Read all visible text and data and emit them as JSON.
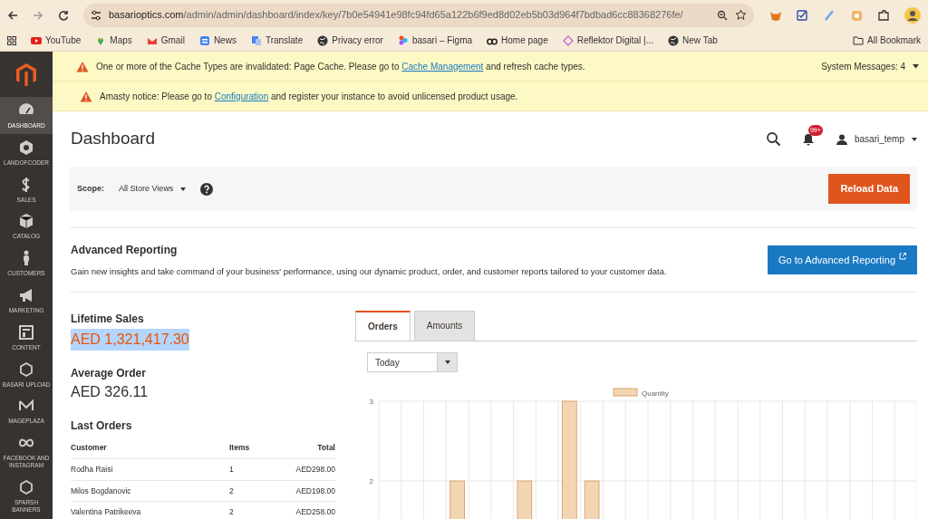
{
  "browser": {
    "url_host": "basarioptics.com",
    "url_path": "/admin/admin/dashboard/index/key/7b0e54941e98fc94fd65a122b6f9ed8d02eb5b03d964f7bdbad6cc88368276fe/",
    "bookmarks": [
      {
        "label": "YouTube"
      },
      {
        "label": "Maps"
      },
      {
        "label": "Gmail"
      },
      {
        "label": "News"
      },
      {
        "label": "Translate"
      },
      {
        "label": "Privacy error"
      },
      {
        "label": "basari – Figma"
      },
      {
        "label": "Home page"
      },
      {
        "label": "Reflektor Digital |..."
      },
      {
        "label": "New Tab"
      }
    ],
    "all_bookmarks": "All Bookmark"
  },
  "sidebar": {
    "items": [
      {
        "label": "DASHBOARD",
        "selected": true
      },
      {
        "label": "LANDOFCODER",
        "selected": false
      },
      {
        "label": "SALES",
        "selected": false
      },
      {
        "label": "CATALOG",
        "selected": false
      },
      {
        "label": "CUSTOMERS",
        "selected": false
      },
      {
        "label": "MARKETING",
        "selected": false
      },
      {
        "label": "CONTENT",
        "selected": false
      },
      {
        "label": "BASARI UPLOAD",
        "selected": false
      },
      {
        "label": "MAGEPLAZA",
        "selected": false
      },
      {
        "label": "FACEBOOK AND INSTAGRAM",
        "selected": false
      },
      {
        "label": "SPARSH BANNERS",
        "selected": false
      }
    ]
  },
  "messages": [
    {
      "before": "One or more of the Cache Types are invalidated: Page Cache. Please go to ",
      "link": "Cache Management",
      "after": " and refresh cache types."
    },
    {
      "before": "Amasty notice: Please go to ",
      "link": "Configuration",
      "after": " and register your instance to avoid unlicensed product usage."
    }
  ],
  "system_messages": "System Messages: 4",
  "header": {
    "title": "Dashboard",
    "notifications": "99+",
    "user": "basari_temp"
  },
  "scope": {
    "label": "Scope:",
    "value": "All Store Views"
  },
  "reload_button": "Reload Data",
  "advanced_reporting": {
    "title": "Advanced Reporting",
    "description": "Gain new insights and take command of your business' performance, using our dynamic product, order, and customer reports tailored to your customer data.",
    "button": "Go to Advanced Reporting"
  },
  "lifetime_sales": {
    "label": "Lifetime Sales",
    "value": "AED 1,321,417.30",
    "highlighted": true
  },
  "average_order": {
    "label": "Average Order",
    "value": "AED 326.11"
  },
  "last_orders": {
    "title": "Last Orders",
    "columns": [
      "Customer",
      "Items",
      "Total"
    ],
    "rows": [
      [
        "Rodha Raisi",
        "1",
        "AED298.00"
      ],
      [
        "Milos Bogdanovic",
        "2",
        "AED198.00"
      ],
      [
        "Valentina Patrikeeva",
        "2",
        "AED258.00"
      ]
    ]
  },
  "tabs": [
    {
      "label": "Orders",
      "selected": true
    },
    {
      "label": "Amounts",
      "selected": false
    }
  ],
  "period": {
    "value": "Today"
  },
  "chart_data": {
    "type": "bar",
    "ylim": [
      0,
      3
    ],
    "yticks": [
      2,
      3
    ],
    "series": [
      {
        "name": "Quantity",
        "color": "#f2d6b3",
        "values": [
          null,
          null,
          null,
          2,
          null,
          null,
          2,
          null,
          3,
          2,
          null,
          null,
          null,
          null,
          null,
          null,
          null,
          null,
          null,
          null,
          null,
          null,
          null,
          null
        ]
      }
    ]
  }
}
